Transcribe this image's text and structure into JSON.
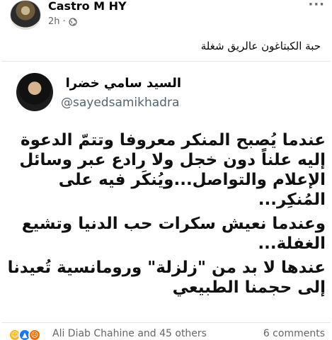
{
  "post": {
    "author": "Castro M HY",
    "time": "2h",
    "more_icon": "···",
    "caption": "حبة الكبتاغون عالريق شغلة"
  },
  "tweet": {
    "name": "السيد سامي خضرا",
    "handle": "@sayedsamikhadra",
    "paragraphs": [
      "عندما يُصبح المنكر معروفا وتتمّ الدعوة إليه علناً دون خجل ولا رادع عبر وسائل الإعلام والتواصل...ويُنكَر فيه على المُنكِر...",
      "وعندما نعيش سكرات حب الدنيا وتشيع الغفلة...",
      "عندها لا بد من \"زلزلة\" ورومانسية تُعيدنا إلى حجمنا الطبيعي"
    ]
  },
  "footer": {
    "reactions_text": "Ali Diab Chahine and 45 others",
    "comments_text": "6 comments",
    "reaction_icons": [
      "haha-icon",
      "like-icon",
      "angry-icon"
    ]
  },
  "colors": {
    "secondary_text": "#65676b",
    "like_blue": "#1877f2",
    "haha_yellow": "#f7b928",
    "angry_orange": "#e9710f"
  }
}
